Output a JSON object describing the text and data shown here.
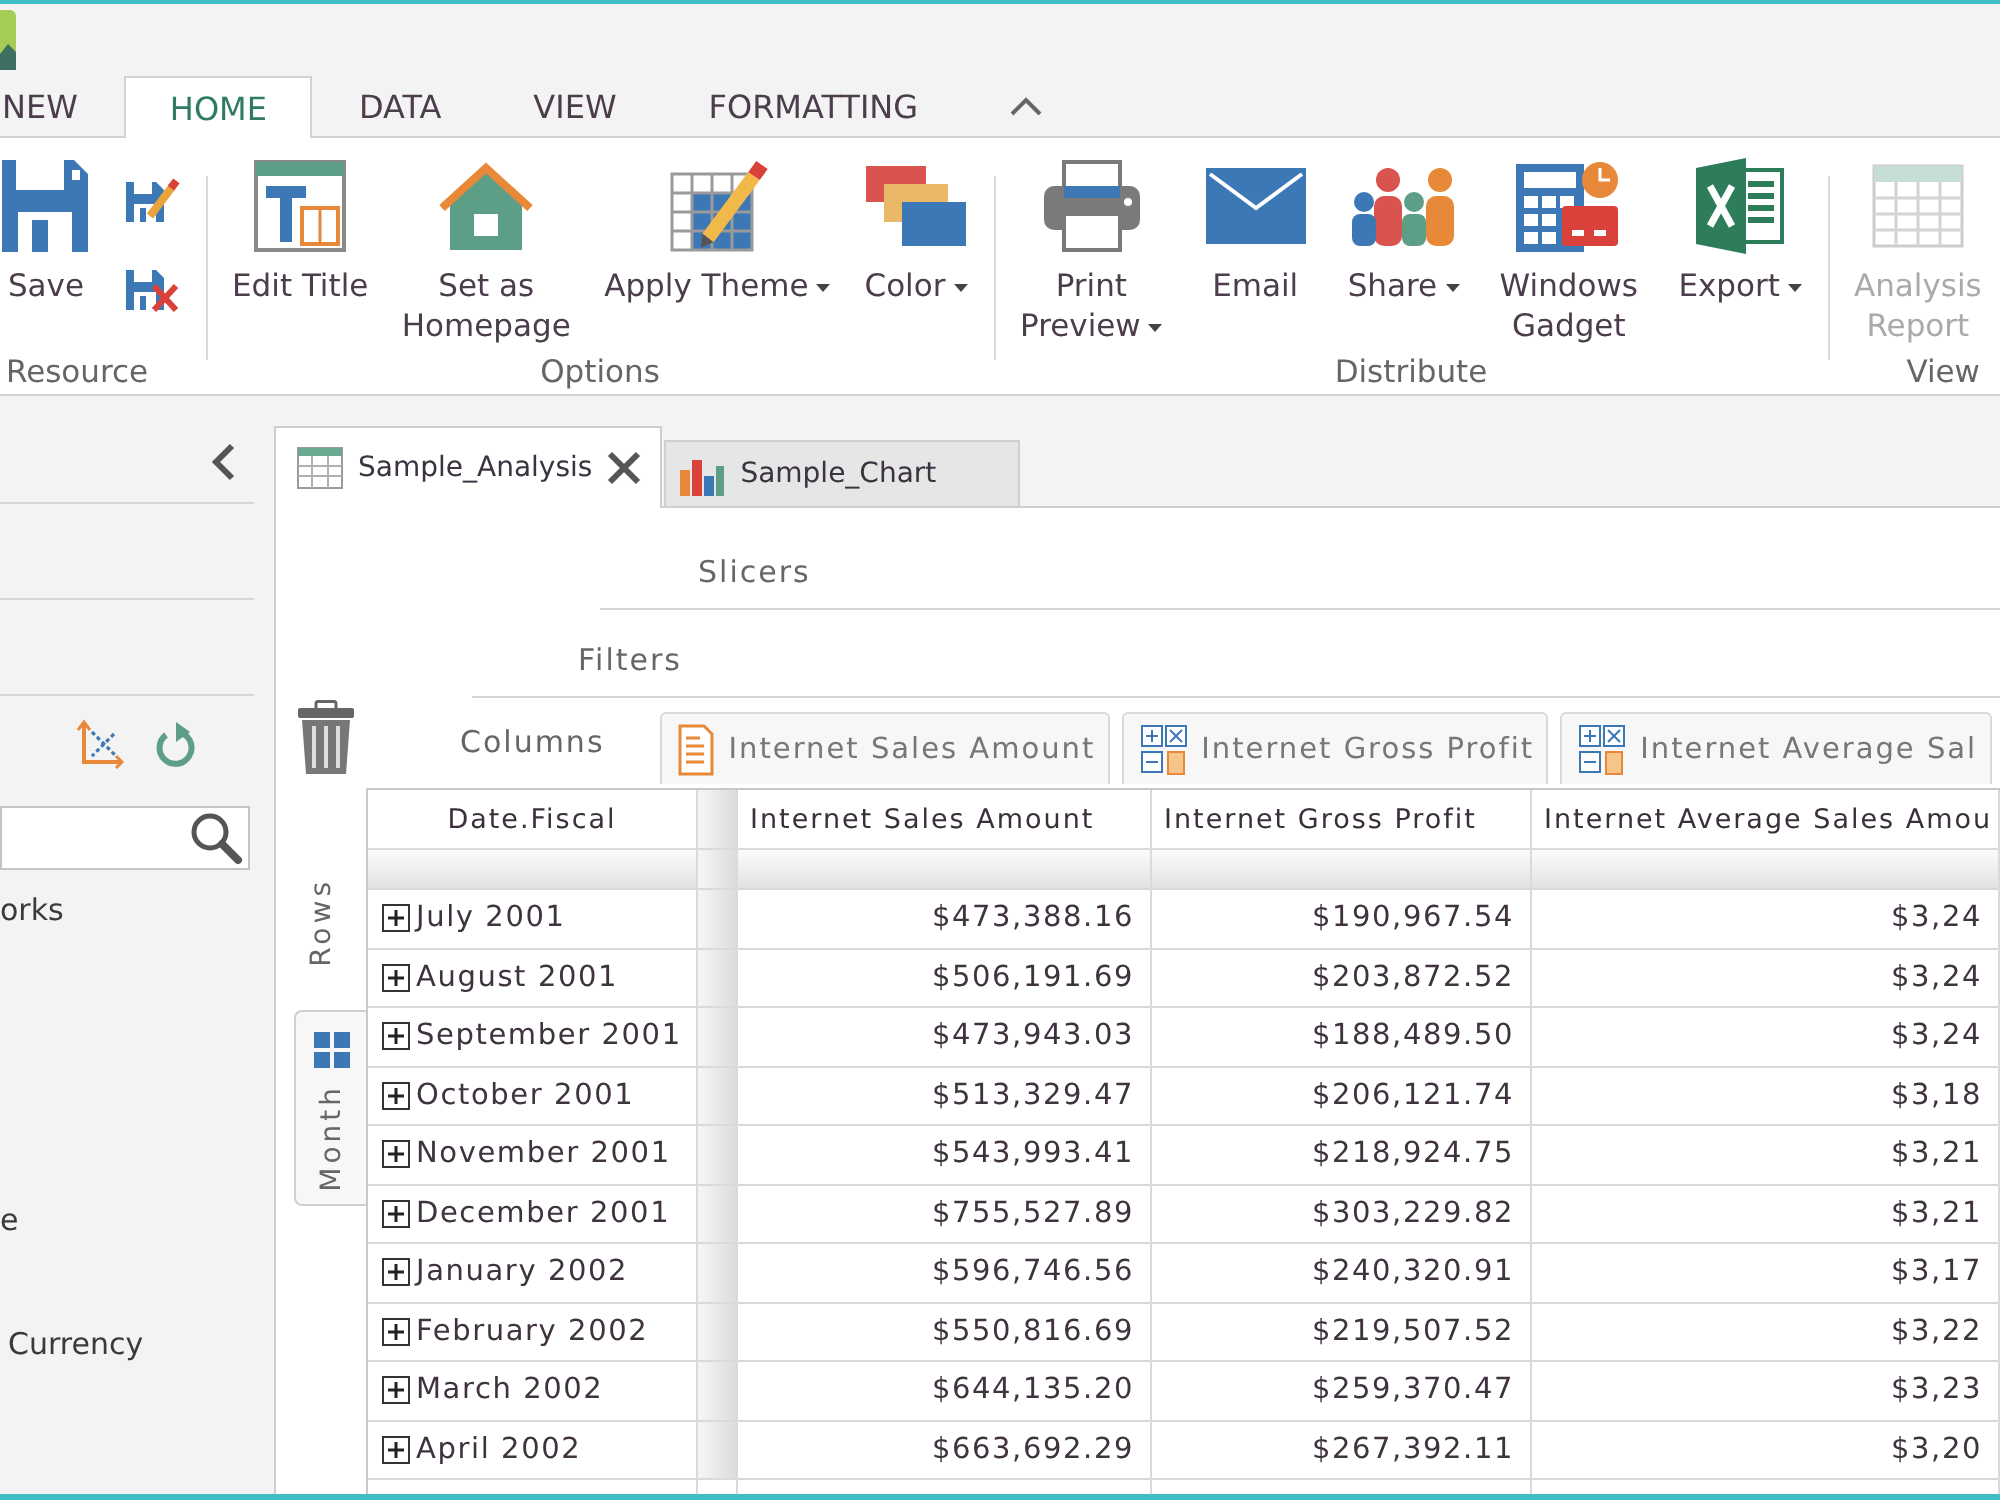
{
  "ribbon_tabs": [
    {
      "label": "NEW",
      "selected": false
    },
    {
      "label": "HOME",
      "selected": true
    },
    {
      "label": "DATA",
      "selected": false
    },
    {
      "label": "VIEW",
      "selected": false
    },
    {
      "label": "FORMATTING",
      "selected": false
    }
  ],
  "ribbon": {
    "groups": [
      {
        "label": "Resource",
        "buttons": [
          {
            "kind": "large",
            "label": "Save",
            "dropdown": false,
            "disabled": false
          },
          {
            "kind": "small",
            "dropdown": false,
            "disabled": false
          },
          {
            "kind": "small",
            "dropdown": false,
            "disabled": false
          }
        ]
      },
      {
        "label": "Options",
        "buttons": [
          {
            "kind": "large",
            "label": "Edit Title",
            "dropdown": false,
            "disabled": false
          },
          {
            "kind": "large",
            "label": "Set as\nHomepage",
            "dropdown": false,
            "disabled": false
          },
          {
            "kind": "large",
            "label": "Apply Theme",
            "dropdown": true,
            "disabled": false
          },
          {
            "kind": "large",
            "label": "Color",
            "dropdown": true,
            "disabled": false
          }
        ]
      },
      {
        "label": "Distribute",
        "buttons": [
          {
            "kind": "large",
            "label": "Print\nPreview",
            "dropdown": true,
            "disabled": false
          },
          {
            "kind": "large",
            "label": "Email",
            "dropdown": false,
            "disabled": false
          },
          {
            "kind": "large",
            "label": "Share",
            "dropdown": true,
            "disabled": false
          },
          {
            "kind": "large",
            "label": "Windows\nGadget",
            "dropdown": false,
            "disabled": false
          },
          {
            "kind": "large",
            "label": "Export",
            "dropdown": true,
            "disabled": false
          }
        ]
      },
      {
        "label": "View",
        "buttons": [
          {
            "kind": "large",
            "label": "Analysis\nReport",
            "dropdown": false,
            "disabled": true
          }
        ]
      }
    ]
  },
  "sidebar": {
    "items": [
      {
        "label": "orks"
      },
      {
        "label": "e"
      },
      {
        "label": "Currency"
      }
    ]
  },
  "documents": [
    {
      "label": "Sample_Analysis",
      "kind": "analysis",
      "selected": true
    },
    {
      "label": "Sample_Chart",
      "kind": "chart",
      "selected": false
    }
  ],
  "pivot": {
    "slicers_label": "Slicers",
    "filters_label": "Filters",
    "columns_label": "Columns",
    "column_fields": [
      {
        "label": "Internet Sales Amount",
        "kind": "measure"
      },
      {
        "label": "Internet Gross Profit",
        "kind": "calculated"
      },
      {
        "label": "Internet Average Sal",
        "kind": "calculated"
      }
    ],
    "rows_label": "Rows",
    "row_fields": [
      {
        "label": "Month"
      }
    ]
  },
  "table": {
    "columns": [
      "Date.Fiscal",
      "Internet Sales Amount",
      "Internet Gross Profit",
      "Internet Average Sales Amou"
    ],
    "rows": [
      {
        "label": "July 2001",
        "expanded": false,
        "values": [
          "$473,388.16",
          "$190,967.54",
          "$3,24"
        ]
      },
      {
        "label": "August 2001",
        "expanded": false,
        "values": [
          "$506,191.69",
          "$203,872.52",
          "$3,24"
        ]
      },
      {
        "label": "September 2001",
        "expanded": false,
        "values": [
          "$473,943.03",
          "$188,489.50",
          "$3,24"
        ]
      },
      {
        "label": "October 2001",
        "expanded": false,
        "values": [
          "$513,329.47",
          "$206,121.74",
          "$3,18"
        ]
      },
      {
        "label": "November 2001",
        "expanded": false,
        "values": [
          "$543,993.41",
          "$218,924.75",
          "$3,21"
        ]
      },
      {
        "label": "December 2001",
        "expanded": false,
        "values": [
          "$755,527.89",
          "$303,229.82",
          "$3,21"
        ]
      },
      {
        "label": "January 2002",
        "expanded": false,
        "values": [
          "$596,746.56",
          "$240,320.91",
          "$3,17"
        ]
      },
      {
        "label": "February 2002",
        "expanded": false,
        "values": [
          "$550,816.69",
          "$219,507.52",
          "$3,22"
        ]
      },
      {
        "label": "March 2002",
        "expanded": false,
        "values": [
          "$644,135.20",
          "$259,370.47",
          "$3,23"
        ]
      },
      {
        "label": "April 2002",
        "expanded": false,
        "values": [
          "$663,692.29",
          "$267,392.11",
          "$3,20"
        ]
      }
    ]
  }
}
